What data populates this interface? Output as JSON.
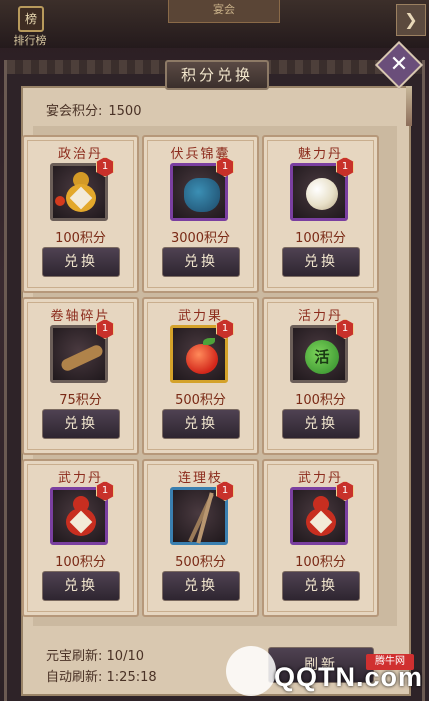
{
  "header": {
    "rank_label": "排行榜",
    "rank_icon_glyph": "榜",
    "center_tab": "宴会",
    "next_arrow": "❯"
  },
  "dialog": {
    "title": "积分兑换",
    "close_glyph": "✕",
    "score_label": "宴会积分:",
    "score_value": "1500"
  },
  "items": [
    {
      "name": "政治丹",
      "cost": "100积分",
      "badge": "1",
      "button": "兑换",
      "icon": "gourd-gold-icon"
    },
    {
      "name": "伏兵锦囊",
      "cost": "3000积分",
      "badge": "1",
      "button": "兑换",
      "icon": "pouch-icon"
    },
    {
      "name": "魅力丹",
      "cost": "100积分",
      "badge": "1",
      "button": "兑换",
      "icon": "pearl-icon"
    },
    {
      "name": "卷轴碎片",
      "cost": "75积分",
      "badge": "1",
      "button": "兑换",
      "icon": "scroll-icon"
    },
    {
      "name": "武力果",
      "cost": "500积分",
      "badge": "1",
      "button": "兑换",
      "icon": "apple-icon"
    },
    {
      "name": "活力丹",
      "cost": "100积分",
      "badge": "1",
      "button": "兑换",
      "icon": "jade-icon",
      "glyph": "活"
    },
    {
      "name": "武力丹",
      "cost": "100积分",
      "badge": "1",
      "button": "兑换",
      "icon": "gourd-red-icon"
    },
    {
      "name": "连理枝",
      "cost": "500积分",
      "badge": "1",
      "button": "兑换",
      "icon": "branch-icon"
    },
    {
      "name": "武力丹",
      "cost": "100积分",
      "badge": "1",
      "button": "兑换",
      "icon": "gourd-red-icon"
    }
  ],
  "footer": {
    "yuanbao_label": "元宝刷新:",
    "yuanbao_value": "10/10",
    "auto_label": "自动刷新:",
    "auto_value": "1:25:18",
    "refresh_button": "刷新"
  },
  "watermark": {
    "text": "QQTN.com",
    "badge": "腾牛网"
  },
  "colors": {
    "parchment": "#d9c8b0",
    "item_name": "#8c2b1c",
    "button_bg": "#3a2f3c",
    "badge_red": "#c8312a"
  }
}
